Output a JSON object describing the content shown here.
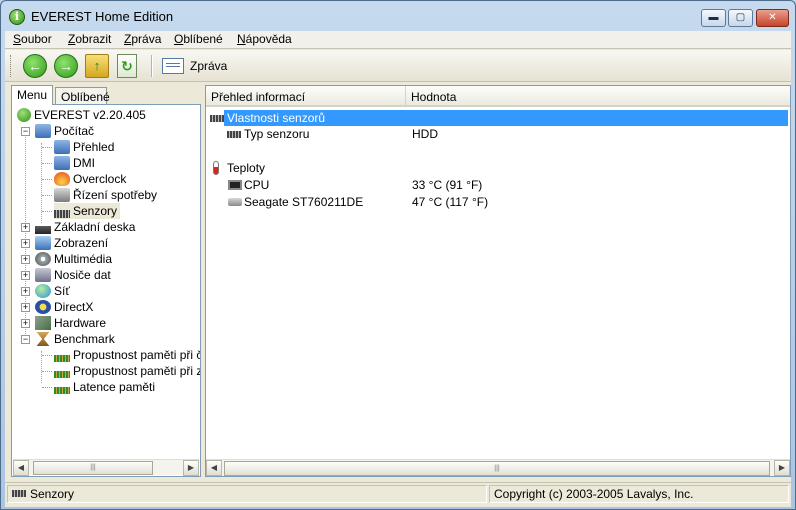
{
  "window": {
    "title": "EVEREST Home Edition",
    "minimize_glyph": "▬",
    "maximize_glyph": "▢",
    "close_glyph": "✕"
  },
  "menubar": {
    "items": [
      "Soubor",
      "Zobrazit",
      "Zpráva",
      "Oblíbené",
      "Nápověda"
    ]
  },
  "toolbar": {
    "back_glyph": "←",
    "forward_glyph": "→",
    "up_glyph": "↑",
    "refresh_glyph": "↻",
    "report_label": "Zpráva"
  },
  "left_pane": {
    "tabs": [
      "Menu",
      "Oblíbené"
    ],
    "tree": {
      "root": "EVEREST v2.20.405",
      "computer": "Počítač",
      "computer_children": [
        "Přehled",
        "DMI",
        "Overclock",
        "Řízení spotřeby",
        "Senzory"
      ],
      "categories": [
        "Základní deska",
        "Zobrazení",
        "Multimédia",
        "Nosiče dat",
        "Síť",
        "DirectX",
        "Hardware"
      ],
      "benchmark": "Benchmark",
      "benchmark_children": [
        "Propustnost paměti při čtení",
        "Propustnost paměti při zápisu",
        "Latence paměti"
      ]
    }
  },
  "right_pane": {
    "columns": [
      "Přehled informací",
      "Hodnota"
    ],
    "rows": [
      {
        "field": "Vlastnosti senzorů",
        "value": ""
      },
      {
        "field": "Typ senzoru",
        "value": "HDD"
      },
      {
        "field": "Teploty",
        "value": ""
      },
      {
        "field": "CPU",
        "value": "33 °C  (91 °F)"
      },
      {
        "field": "Seagate ST760211DE",
        "value": "47 °C  (117 °F)"
      }
    ]
  },
  "scroll": {
    "left_arrow": "◀",
    "right_arrow": "▶",
    "thumb_grip": "|||"
  },
  "statusbar": {
    "left": "Senzory",
    "right": "Copyright (c) 2003-2005 Lavalys, Inc."
  }
}
